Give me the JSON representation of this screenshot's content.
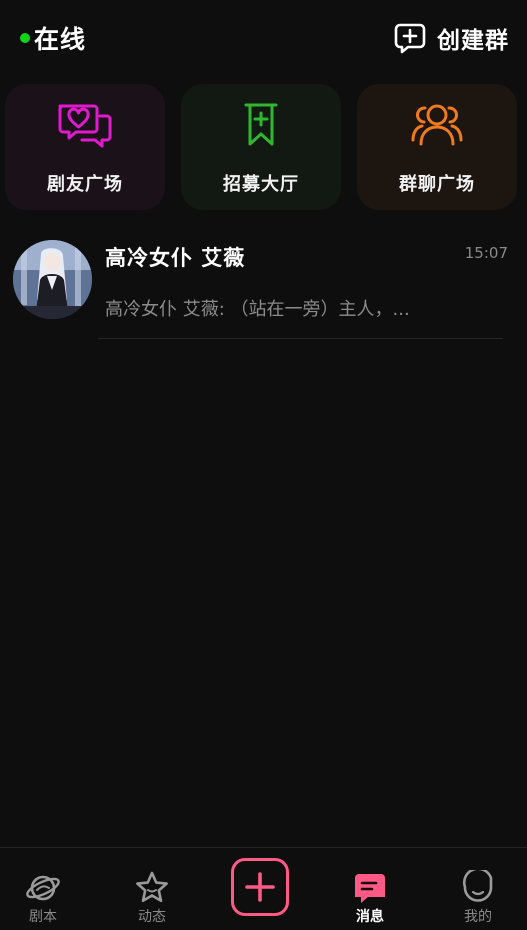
{
  "header": {
    "status_label": "在线",
    "status_color": "#12d418",
    "create_group_label": "创建群",
    "create_group_icon": "add-chat-icon"
  },
  "categories": [
    {
      "label": "剧友广场",
      "icon": "heart-chat-icon",
      "color": "#e11ad0"
    },
    {
      "label": "招募大厅",
      "icon": "bookmark-plus-icon",
      "color": "#2fb82f"
    },
    {
      "label": "群聊广场",
      "icon": "group-people-icon",
      "color": "#f07a1c"
    }
  ],
  "chats": [
    {
      "name": "高冷女仆 艾薇",
      "time": "15:07",
      "preview": "高冷女仆 艾薇: （站在一旁）主人，..."
    }
  ],
  "bottom_nav": {
    "items": [
      {
        "label": "剧本",
        "icon": "planet-icon"
      },
      {
        "label": "动态",
        "icon": "star-icon"
      },
      {
        "label": "",
        "icon": "plus-icon",
        "color": "#ff5a86"
      },
      {
        "label": "消息",
        "icon": "message-icon",
        "active": true
      },
      {
        "label": "我的",
        "icon": "profile-icon"
      }
    ]
  }
}
